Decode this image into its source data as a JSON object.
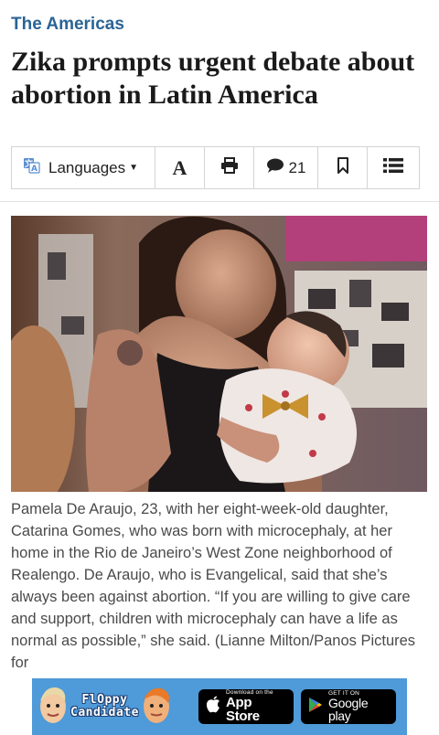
{
  "section": "The Americas",
  "headline": "Zika prompts urgent debate about abortion in Latin America",
  "toolbar": {
    "languages_label": "Languages",
    "font_label": "A",
    "comment_count": "21"
  },
  "caption": "Pamela De Araujo, 23, with her eight-week-old daughter, Catarina Gomes, who was born with microcephaly, at her home in the Rio de Janeiro’s West Zone neighborhood of Realengo. De Araujo, who is Evangelical, said that she’s always been against abortion. “If you are willing to give care and support, children with microcephaly can have a life as normal as possible,” she said. (Lianne Milton/Panos Pictures for",
  "ad": {
    "game_title_line1": "FlOppy",
    "game_title_line2": "Candidate",
    "apple_small": "Download on the",
    "apple_big": "App Store",
    "google_small": "GET IT ON",
    "google_big": "Google play"
  },
  "icons": [
    "translate-icon",
    "print-icon",
    "comment-icon",
    "bookmark-icon",
    "list-icon",
    "apple-icon",
    "play-icon"
  ]
}
